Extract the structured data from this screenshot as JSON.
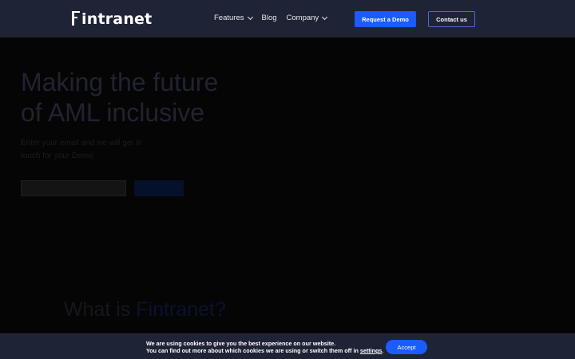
{
  "header": {
    "logo_rest": "intranet",
    "nav": {
      "features": "Features",
      "blog": "Blog",
      "company": "Company"
    },
    "request_demo": "Request a Demo",
    "contact": "Contact us"
  },
  "hero": {
    "title_line1": "Making the future",
    "title_line2": "of AML inclusive",
    "subtitle_line1": "Enter your email and we will get in",
    "subtitle_line2": "touch for your Demo",
    "email_placeholder": "",
    "submit_label": "",
    "note": ""
  },
  "section": {
    "what_is_prefix": "What is ",
    "what_is_brand": "Fintranet?"
  },
  "cookie": {
    "line1": "We are using cookies to give you the best experience on our website.",
    "line2_prefix": "You can find out more about which cookies we are using or switch them off in ",
    "settings_link": "settings",
    "line2_suffix": ".",
    "accept": "Accept"
  },
  "colors": {
    "header_bg": "#1f2336",
    "accent": "#1a5cff",
    "page_bg": "#050505"
  }
}
